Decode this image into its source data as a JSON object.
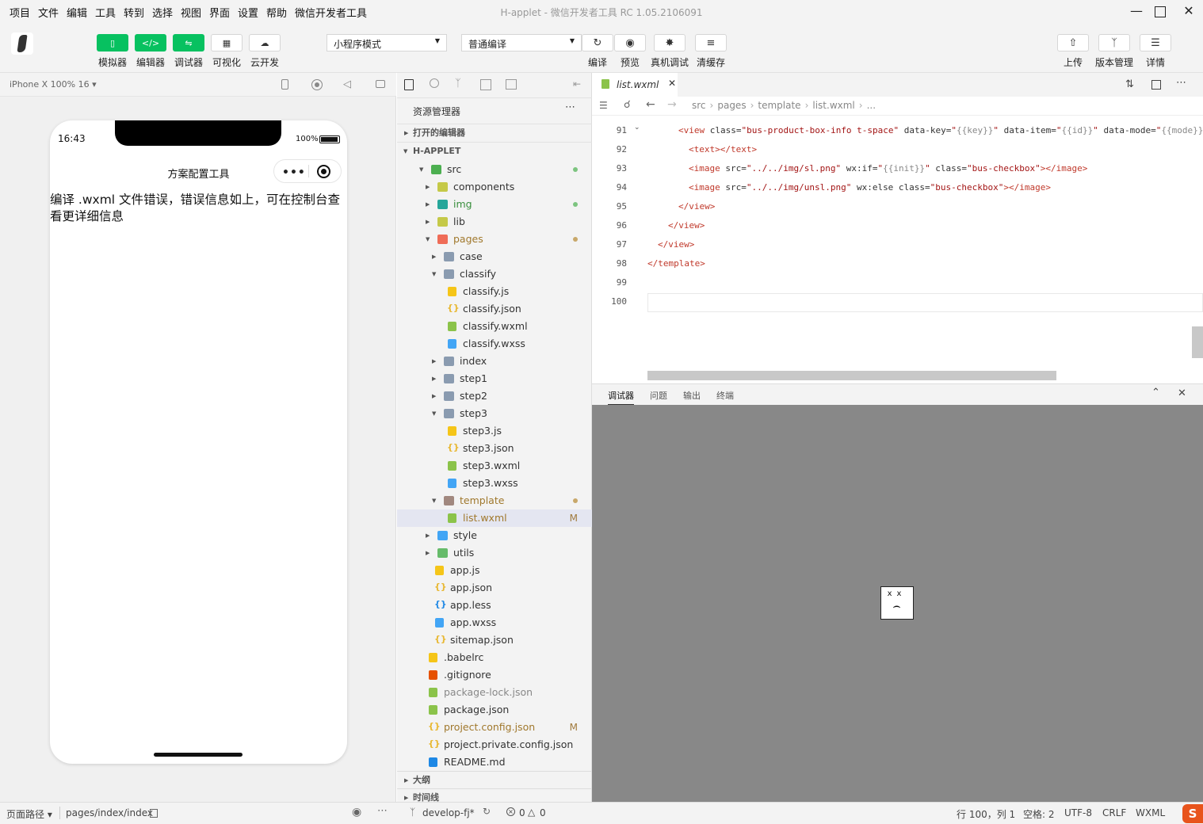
{
  "menubar": {
    "items": [
      "项目",
      "文件",
      "编辑",
      "工具",
      "转到",
      "选择",
      "视图",
      "界面",
      "设置",
      "帮助",
      "微信开发者工具"
    ],
    "title": "H-applet - 微信开发者工具 RC 1.05.2106091"
  },
  "toolbar": {
    "left_buttons": [
      {
        "label": "模拟器",
        "icon": "phone-icon",
        "active": true
      },
      {
        "label": "编辑器",
        "icon": "code-icon",
        "active": true
      },
      {
        "label": "调试器",
        "icon": "debug-icon",
        "active": true
      },
      {
        "label": "可视化",
        "icon": "layout-icon",
        "active": false
      },
      {
        "label": "云开发",
        "icon": "cloud-icon",
        "active": false
      }
    ],
    "mode_select": "小程序模式",
    "compile_select": "普通编译",
    "mid_buttons": [
      {
        "label": "编译",
        "icon": "refresh-icon"
      },
      {
        "label": "预览",
        "icon": "eye-icon"
      },
      {
        "label": "真机调试",
        "icon": "bug-icon"
      },
      {
        "label": "清缓存",
        "icon": "layers-icon"
      }
    ],
    "right_buttons": [
      {
        "label": "上传",
        "icon": "upload-icon"
      },
      {
        "label": "版本管理",
        "icon": "branch-icon"
      },
      {
        "label": "详情",
        "icon": "menu-icon"
      }
    ]
  },
  "simulator": {
    "device": "iPhone X 100% 16 ▾",
    "time": "16:43",
    "battery": "100%",
    "nav_title": "方案配置工具",
    "error_text": "编译 .wxml 文件错误，错误信息如上，可在控制台查看更详细信息"
  },
  "explorer": {
    "title": "资源管理器",
    "open_editors": "打开的编辑器",
    "project": "H-APPLET",
    "outline": "大纲",
    "timeline": "时间线",
    "tree": [
      {
        "name": "src",
        "depth": 0,
        "folder": true,
        "open": true,
        "color": "#4caf50",
        "dot": "#7cc47f"
      },
      {
        "name": "components",
        "depth": 1,
        "folder": true,
        "open": false,
        "color": "#c5c948"
      },
      {
        "name": "img",
        "depth": 1,
        "folder": true,
        "open": false,
        "color": "#26a69a",
        "dot": "#7cc47f",
        "green": true
      },
      {
        "name": "lib",
        "depth": 1,
        "folder": true,
        "open": false,
        "color": "#c5c948"
      },
      {
        "name": "pages",
        "depth": 1,
        "folder": true,
        "open": true,
        "color": "#ef6c57",
        "dot": "#c8a86a",
        "gold": true
      },
      {
        "name": "case",
        "depth": 2,
        "folder": true,
        "open": false,
        "color": "#8a9bb0"
      },
      {
        "name": "classify",
        "depth": 2,
        "folder": true,
        "open": true,
        "color": "#8a9bb0"
      },
      {
        "name": "classify.js",
        "depth": 3,
        "folder": false,
        "color": "#f5c518"
      },
      {
        "name": "classify.json",
        "depth": 3,
        "folder": false,
        "color": "#e8b730",
        "brace": true
      },
      {
        "name": "classify.wxml",
        "depth": 3,
        "folder": false,
        "color": "#8bc34a"
      },
      {
        "name": "classify.wxss",
        "depth": 3,
        "folder": false,
        "color": "#42a5f5"
      },
      {
        "name": "index",
        "depth": 2,
        "folder": true,
        "open": false,
        "color": "#8a9bb0"
      },
      {
        "name": "step1",
        "depth": 2,
        "folder": true,
        "open": false,
        "color": "#8a9bb0"
      },
      {
        "name": "step2",
        "depth": 2,
        "folder": true,
        "open": false,
        "color": "#8a9bb0"
      },
      {
        "name": "step3",
        "depth": 2,
        "folder": true,
        "open": true,
        "color": "#8a9bb0"
      },
      {
        "name": "step3.js",
        "depth": 3,
        "folder": false,
        "color": "#f5c518"
      },
      {
        "name": "step3.json",
        "depth": 3,
        "folder": false,
        "color": "#e8b730",
        "brace": true
      },
      {
        "name": "step3.wxml",
        "depth": 3,
        "folder": false,
        "color": "#8bc34a"
      },
      {
        "name": "step3.wxss",
        "depth": 3,
        "folder": false,
        "color": "#42a5f5"
      },
      {
        "name": "template",
        "depth": 2,
        "folder": true,
        "open": true,
        "color": "#a1887f",
        "dot": "#c8a86a",
        "gold": true
      },
      {
        "name": "list.wxml",
        "depth": 3,
        "folder": false,
        "color": "#8bc34a",
        "badge": "M",
        "gold": true,
        "selected": true
      },
      {
        "name": "style",
        "depth": 1,
        "folder": true,
        "open": false,
        "color": "#42a5f5"
      },
      {
        "name": "utils",
        "depth": 1,
        "folder": true,
        "open": false,
        "color": "#66bb6a"
      },
      {
        "name": "app.js",
        "depth": 1,
        "folder": false,
        "color": "#f5c518"
      },
      {
        "name": "app.json",
        "depth": 1,
        "folder": false,
        "color": "#e8b730",
        "brace": true
      },
      {
        "name": "app.less",
        "depth": 1,
        "folder": false,
        "color": "#1e88e5",
        "brace": true
      },
      {
        "name": "app.wxss",
        "depth": 1,
        "folder": false,
        "color": "#42a5f5"
      },
      {
        "name": "sitemap.json",
        "depth": 1,
        "folder": false,
        "color": "#e8b730",
        "brace": true
      },
      {
        "name": ".babelrc",
        "depth": 0,
        "folder": false,
        "color": "#f5c518"
      },
      {
        "name": ".gitignore",
        "depth": 0,
        "folder": false,
        "color": "#e65100"
      },
      {
        "name": "package-lock.json",
        "depth": 0,
        "folder": false,
        "color": "#8bc34a",
        "dim": true
      },
      {
        "name": "package.json",
        "depth": 0,
        "folder": false,
        "color": "#8bc34a"
      },
      {
        "name": "project.config.json",
        "depth": 0,
        "folder": false,
        "color": "#e8b730",
        "brace": true,
        "badge": "M",
        "gold": true
      },
      {
        "name": "project.private.config.json",
        "depth": 0,
        "folder": false,
        "color": "#e8b730",
        "brace": true
      },
      {
        "name": "README.md",
        "depth": 0,
        "folder": false,
        "color": "#1e88e5"
      }
    ]
  },
  "editor": {
    "tab": "list.wxml",
    "breadcrumb": [
      "src",
      "pages",
      "template",
      "list.wxml",
      "..."
    ],
    "lines": [
      {
        "n": "91",
        "indent": 3,
        "parts": [
          [
            "t",
            "<view"
          ],
          [
            "a",
            " class="
          ],
          [
            "s",
            "\"bus-product-box-info t-space\""
          ],
          [
            "a",
            " data-key="
          ],
          [
            "s",
            "\""
          ],
          [
            "v",
            "{{key}}"
          ],
          [
            "s",
            "\""
          ],
          [
            "a",
            " data-item="
          ],
          [
            "s",
            "\""
          ],
          [
            "v",
            "{{id}}"
          ],
          [
            "s",
            "\""
          ],
          [
            "a",
            " data-mode="
          ],
          [
            "s",
            "\""
          ],
          [
            "v",
            "{{mode}}"
          ]
        ]
      },
      {
        "n": "92",
        "indent": 4,
        "parts": [
          [
            "t",
            "<text></text>"
          ]
        ]
      },
      {
        "n": "93",
        "indent": 4,
        "parts": [
          [
            "t",
            "<image"
          ],
          [
            "a",
            " src="
          ],
          [
            "s",
            "\"../../img/sl.png\""
          ],
          [
            "a",
            " wx:if="
          ],
          [
            "s",
            "\""
          ],
          [
            "v",
            "{{init}}"
          ],
          [
            "s",
            "\""
          ],
          [
            "a",
            " class="
          ],
          [
            "s",
            "\"bus-checkbox\""
          ],
          [
            "t",
            "></image>"
          ]
        ]
      },
      {
        "n": "94",
        "indent": 4,
        "parts": [
          [
            "t",
            "<image"
          ],
          [
            "a",
            " src="
          ],
          [
            "s",
            "\"../../img/unsl.png\""
          ],
          [
            "a",
            " wx:else class="
          ],
          [
            "s",
            "\"bus-checkbox\""
          ],
          [
            "t",
            "></image>"
          ]
        ]
      },
      {
        "n": "95",
        "indent": 3,
        "parts": [
          [
            "t",
            "</view>"
          ]
        ]
      },
      {
        "n": "96",
        "indent": 2,
        "parts": [
          [
            "t",
            "</view>"
          ]
        ]
      },
      {
        "n": "97",
        "indent": 1,
        "parts": [
          [
            "t",
            "</view>"
          ]
        ]
      },
      {
        "n": "98",
        "indent": 0,
        "parts": [
          [
            "t",
            "</template>"
          ]
        ]
      },
      {
        "n": "99",
        "indent": 0,
        "parts": []
      },
      {
        "n": "100",
        "indent": 0,
        "parts": []
      }
    ]
  },
  "debug": {
    "tabs": [
      "调试器",
      "问题",
      "输出",
      "终端"
    ]
  },
  "status": {
    "page_path_label": "页面路径 ▾",
    "page_path": "pages/index/index",
    "branch": "develop-fj*",
    "errors": "0",
    "warnings": "0",
    "position": "行 100，列 1",
    "spaces": "空格: 2",
    "encoding": "UTF-8",
    "eol": "CRLF",
    "language": "WXML"
  }
}
